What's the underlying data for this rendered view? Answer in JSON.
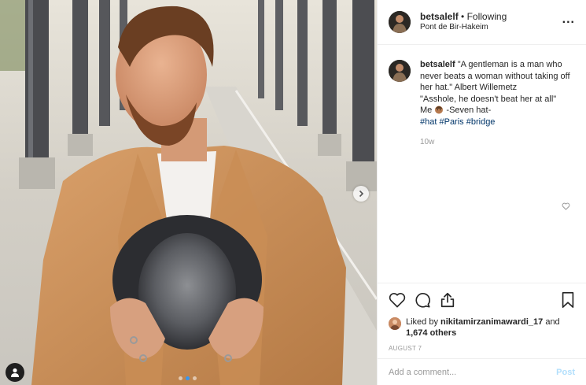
{
  "header": {
    "username": "betsalelf",
    "separator": " • ",
    "follow_status": "Following",
    "location": "Pont de Bir-Hakeim",
    "more_icon": "more-options-icon",
    "more_label": "..."
  },
  "caption": {
    "username": "betsalelf",
    "line1": "\"A gentleman is a man who never beats a woman without taking off her hat.\" Albert Willemetz",
    "line2": "\"Asshole, he doesn't beat her at all\"",
    "line3_prefix": "Me",
    "emoji": "face-emoji",
    "line3_suffix": " -Seven hat-",
    "hashtags": [
      "#hat",
      "#Paris",
      "#bridge"
    ],
    "time_ago": "10w"
  },
  "actions": {
    "icons": [
      "heart-icon",
      "comment-icon",
      "share-icon",
      "bookmark-icon"
    ]
  },
  "likes": {
    "prefix": "Liked by ",
    "user": "nikitamirzanimawardi_17",
    "middle": " and",
    "others": "1,674 others"
  },
  "date": "AUGUST 7",
  "comment_box": {
    "placeholder": "Add a comment...",
    "post_label": "Post"
  },
  "carousel": {
    "total": 3,
    "active_index": 1
  },
  "colors": {
    "hashtag": "#003569",
    "muted": "#999999",
    "post_disabled": "#b2dffc",
    "carousel_active": "#3897f0"
  }
}
